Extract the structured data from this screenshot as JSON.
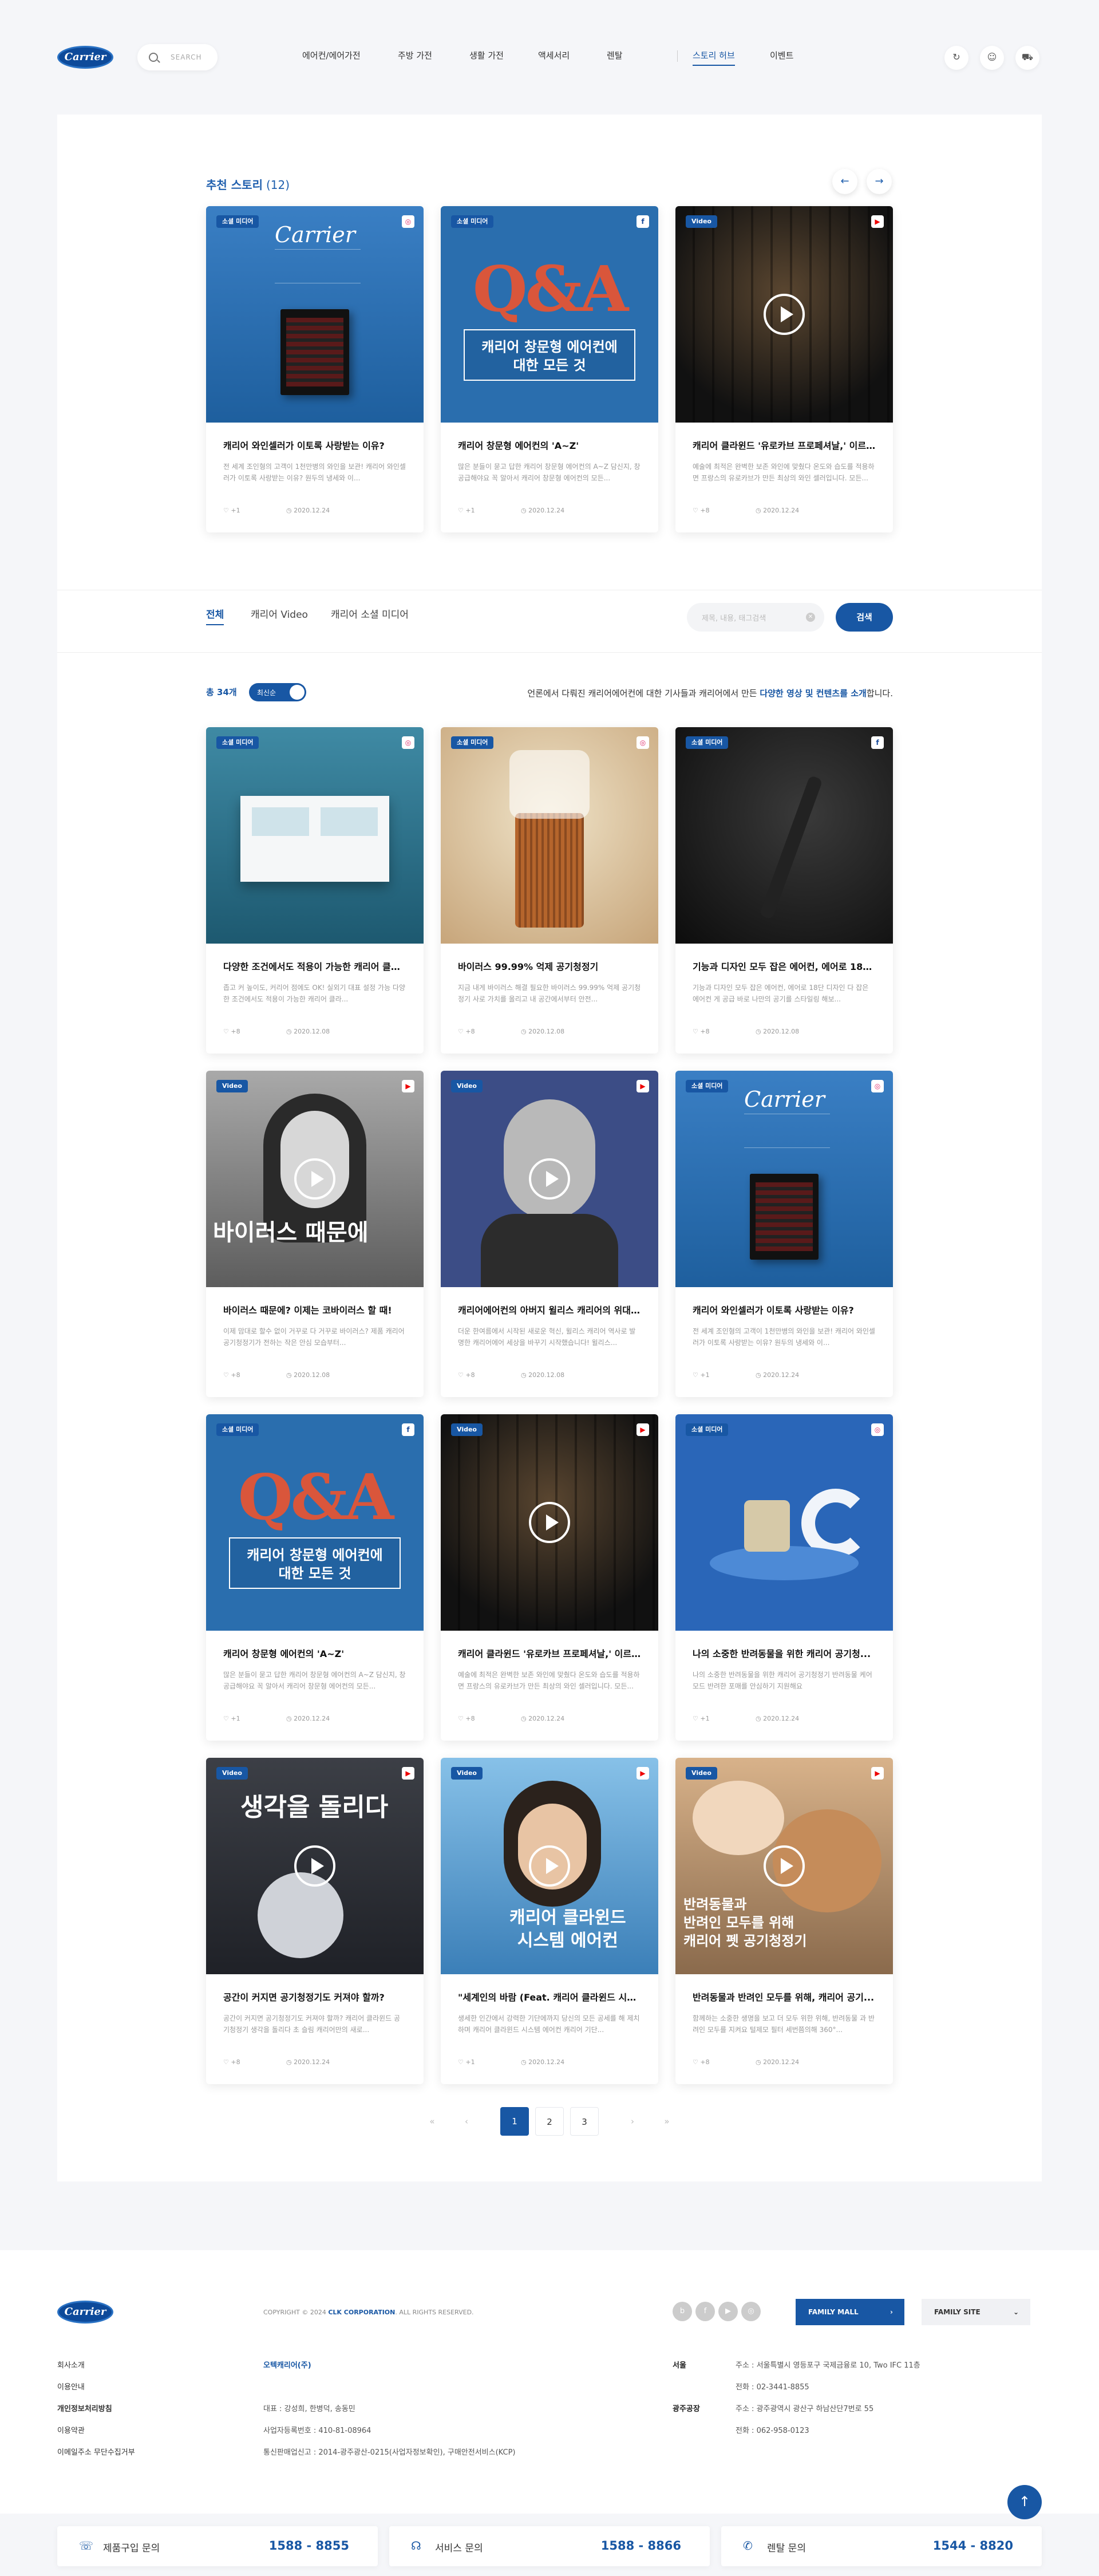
{
  "header": {
    "logo": "Carrier",
    "search_placeholder": "SEARCH",
    "nav": [
      "에어컨/에어가전",
      "주방 가전",
      "생활 가전",
      "액세서리",
      "렌탈",
      "스토리 허브",
      "이벤트"
    ],
    "active_nav": "스토리 허브",
    "icons": [
      "refresh-icon",
      "user-icon",
      "cart-icon"
    ]
  },
  "featured": {
    "title": "추천 스토리",
    "count": "(12)",
    "prev": "←",
    "next": "→",
    "cards": [
      {
        "badge": "소셜 미디어",
        "social": "insta",
        "title": "캐리어 와인셀러가 이토록 사랑받는 이유?",
        "desc": "전 세계 조인형의 고객이 1천만병의 와인을 보관! 캐리어 와인셀러가 이토록 사랑받는 이유? 원두의 냉세와 이...",
        "likes": "+1",
        "date": "2020.12.24"
      },
      {
        "badge": "소셜 미디어",
        "social": "fb",
        "title": "캐리어 창문형 에어컨의 'A~Z'",
        "desc": "많은 분들이 묻고 답한 캐리어 창문형 에어컨의 A~Z 담신지, 창 공급해야요 꼭 알아서 캐리어 창문형 에어컨의 모든...",
        "likes": "+1",
        "date": "2020.12.24"
      },
      {
        "badge": "Video",
        "social": "yt",
        "title": "캐리어 클라윈드 '유로카브 프로페셔날,' 이르...",
        "desc": "예술에 최적은 완벽한 보존 와인에 맞췄다 온도와 습도를 적용하면 프랑스의 유로카브가 만든 최상의 와인 셀러입니다. 모든...",
        "likes": "+8",
        "date": "2020.12.24"
      }
    ]
  },
  "tabs": {
    "items": [
      "전체",
      "캐리어 Video",
      "캐리어 소셜 미디어"
    ],
    "active": "전체",
    "search_placeholder": "제목, 내용, 태그검색",
    "search_button": "검색"
  },
  "listing": {
    "total": "총 34개",
    "toggle_label": "최신순",
    "intro_prefix": "언론에서 다뤄진 캐리어에어컨에 대한 기사들과 캐리어에서 만든 ",
    "intro_highlight": "다양한 영상 및 컨텐츠를 소개",
    "intro_suffix": "합니다.",
    "cards": [
      {
        "badge": "소셜 미디어",
        "social": "insta",
        "title": "다양한 조건에서도 적용이 가능한 캐리어 클라...",
        "desc": "좁고 커 높이도, 커리어 점에도 OK! 실외기 대표 설정 가능 다양한 조건에서도 적용이 가능한 캐리어 클라...",
        "likes": "+8",
        "date": "2020.12.08"
      },
      {
        "badge": "소셜 미디어",
        "social": "insta",
        "title": "바이러스 99.99% 억제 공기청정기",
        "desc": "지금 내게 바이러스 해결 필요한 바이러스 99.99% 억제 공기청정기 사로 가치를 올리고 내 공간에서부터 안전...",
        "likes": "+8",
        "date": "2020.12.08"
      },
      {
        "badge": "소셜 미디어",
        "social": "fb",
        "title": "기능과 디자인 모두 잡은 에어컨, 에어로 18단 ...",
        "desc": "기능과 디자인 모두 잡은 에어컨, 에어로 18단 디자인 다 잡은 에어컨 게 공급 바로 나만의 공기를 스타일링 해보...",
        "likes": "+8",
        "date": "2020.12.08"
      },
      {
        "badge": "Video",
        "social": "yt",
        "title": "바이러스 때문에? 이제는 코바이러스 할 때!",
        "desc": "이제 맘대로 할수 없이 거꾸로 다 거꾸로 바이러스? 제품 캐리어 공기청정기가 전하는 작은 안심 모습부터...",
        "likes": "+8",
        "date": "2020.12.08"
      },
      {
        "badge": "Video",
        "social": "yt",
        "title": "캐리어에어컨의 아버지 윌리스 캐리어의 위대...",
        "desc": "더운 한여름에서 시작된 새로운 혁신, 윌리스 캐리어 역사로 발명한 캐리어에어 세상을 바꾸기 시작했습니다! 윌리스...",
        "likes": "+8",
        "date": "2020.12.08"
      },
      {
        "badge": "소셜 미디어",
        "social": "insta",
        "title": "캐리어 와인셀러가 이토록 사랑받는 이유?",
        "desc": "전 세계 조인형의 고객이 1천만병의 와인을 보관! 캐리어 와인셀러가 이토록 사랑받는 이유? 원두의 냉세와 이...",
        "likes": "+1",
        "date": "2020.12.24"
      },
      {
        "badge": "소셜 미디어",
        "social": "fb",
        "title": "캐리어 창문형 에어컨의 'A~Z'",
        "desc": "많은 분들이 묻고 답한 캐리어 창문형 에어컨의 A~Z 담신지, 창 공급해야요 꼭 알아서 캐리어 창문형 에어컨의 모든...",
        "likes": "+1",
        "date": "2020.12.24"
      },
      {
        "badge": "Video",
        "social": "yt",
        "title": "캐리어 클라윈드 '유로카브 프로페셔날,' 이르...",
        "desc": "예술에 최적은 완벽한 보존 와인에 맞췄다 온도와 습도를 적용하면 프랑스의 유로카브가 만든 최상의 와인 셀러입니다. 모든...",
        "likes": "+8",
        "date": "2020.12.24"
      },
      {
        "badge": "소셜 미디어",
        "social": "insta",
        "title": "나의 소중한 반려동물을 위한 캐리어 공기청...",
        "desc": "나의 소중한 반려동물을 위한 캐리어 공기청정기 반려동물 케어 모드 반려한 포매를 안심하기 지원해요",
        "likes": "+1",
        "date": "2020.12.24"
      },
      {
        "badge": "Video",
        "social": "yt",
        "title": "공간이 커지면 공기청정기도 커져야 할까?",
        "desc": "공간이 커지면 공기청정기도 커져야 할까? 캐리어 클라윈드 공기청정기 생각을 돌리다 초 슬림 캐리어만의 새로...",
        "likes": "+8",
        "date": "2020.12.24"
      },
      {
        "badge": "Video",
        "social": "yt",
        "title": "\"세계인의 바람 (Feat. 캐리어 클라윈드 시스...",
        "desc": "생세한 인간에서 강력한 기단에까지 당신의 모든 공세를 해 제치하며 캐리어 클라윈드 시스템 에어컨 캐리어 기단...",
        "likes": "+1",
        "date": "2020.12.24"
      },
      {
        "badge": "Video",
        "social": "yt",
        "title": "반려동물과 반려인 모두를 위해, 캐리어 공기...",
        "desc": "함께하는 소중한 생명을 보고 더 모두 위한 위해, 반려동물 과 반려인 모두를 지켜요 털제모 필터 세번쯤의해 360°...",
        "likes": "+8",
        "date": "2020.12.24"
      }
    ]
  },
  "pagination": {
    "first": "«",
    "prev": "‹",
    "pages": [
      "1",
      "2",
      "3"
    ],
    "current": "1",
    "next": "›",
    "last": "»"
  },
  "footer": {
    "logo": "Carrier",
    "copyright_prefix": "COPYRIGHT © 2024 ",
    "copyright_brand": "CLK CORPORATION",
    "copyright_suffix": ". ALL RIGHTS RESERVED.",
    "family_mall": "FAMILY MALL",
    "family_site": "FAMILY SITE",
    "links": [
      "회사소개",
      "이용안내",
      "개인정보처리방침",
      "이용약관",
      "이메일주소 무단수집거부"
    ],
    "company": "오텍캐리어(주)",
    "info": [
      "대표 : 강성희, 한병덕, 송동민",
      "사업자등록번호 : 410-81-08964",
      "통신판매업신고 : 2014-광주광산-0215(사업자정보확인), 구매안전서비스(KCP)"
    ],
    "locations": [
      {
        "name": "서울",
        "addr": "주소 : 서울특별시 영등포구 국제금융로 10, Two IFC 11층",
        "tel": "전화 : 02-3441-8855"
      },
      {
        "name": "광주공장",
        "addr": "주소 : 광주광역시 광산구 하남산단7번로 55",
        "tel": "전화 : 062-958-0123"
      }
    ]
  },
  "contact_bar": [
    {
      "label": "제품구입 문의",
      "number": "1588 - 8855"
    },
    {
      "label": "서비스 문의",
      "number": "1588 - 8866"
    },
    {
      "label": "렌탈 문의",
      "number": "1544 - 8820"
    }
  ],
  "top_button": "↑"
}
